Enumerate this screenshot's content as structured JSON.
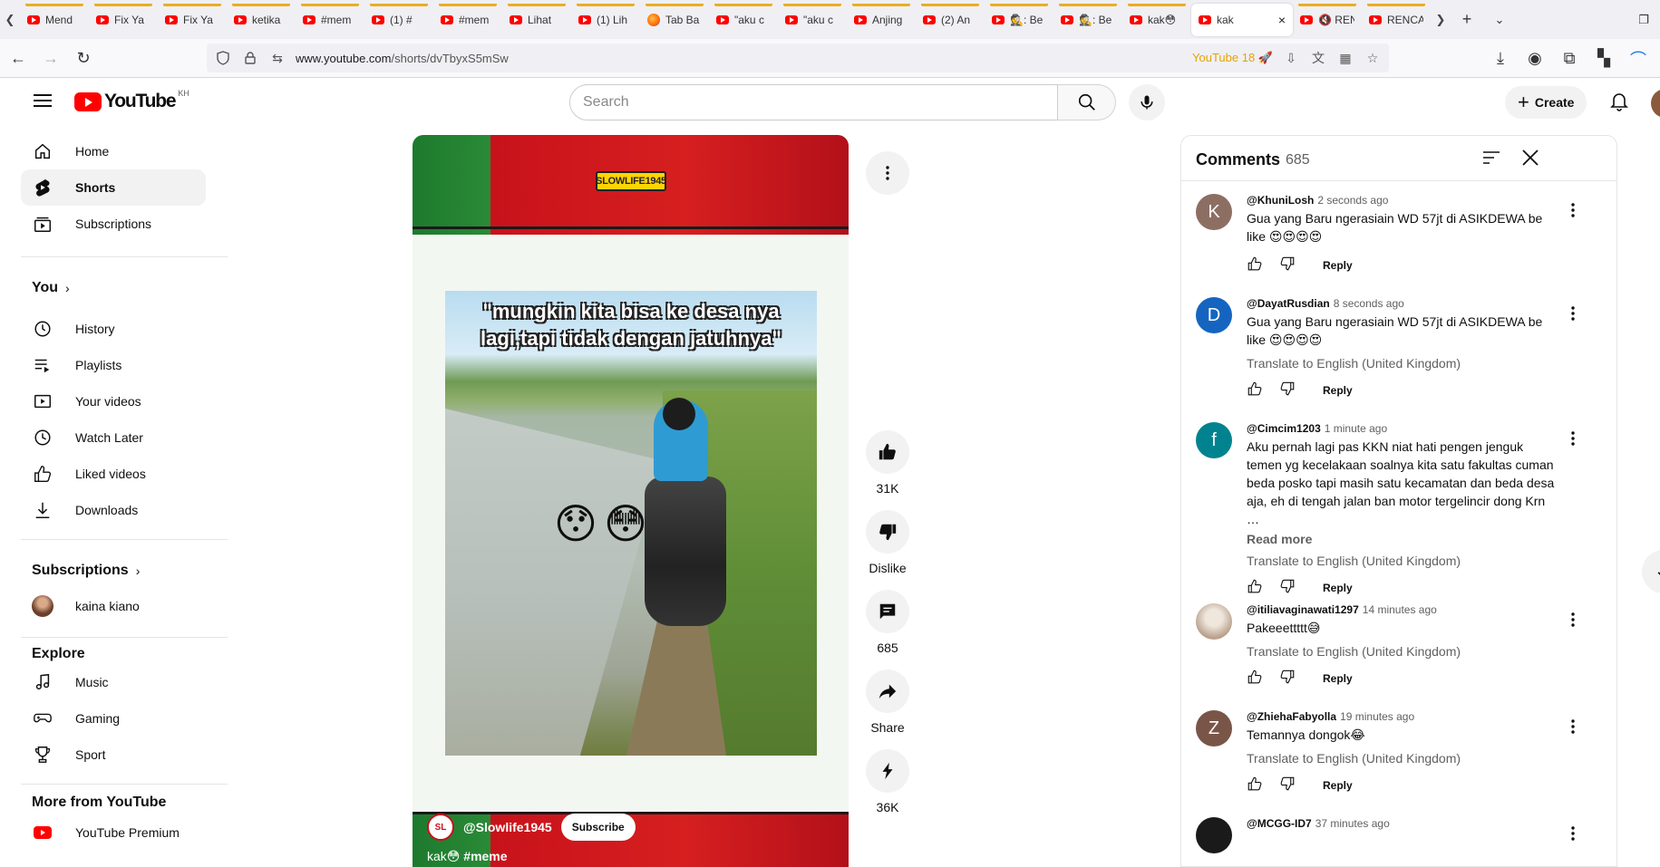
{
  "browser": {
    "tabs": [
      {
        "label": "Mend",
        "icon": "youtube-favicon"
      },
      {
        "label": "Fix Ya",
        "icon": "youtube-favicon"
      },
      {
        "label": "Fix Ya",
        "icon": "youtube-favicon"
      },
      {
        "label": "ketika",
        "icon": "youtube-favicon"
      },
      {
        "label": "#mem",
        "icon": "youtube-favicon"
      },
      {
        "label": "(1) #",
        "icon": "youtube-favicon"
      },
      {
        "label": "#mem",
        "icon": "youtube-favicon"
      },
      {
        "label": "Lihat",
        "icon": "youtube-favicon"
      },
      {
        "label": "(1) Lih",
        "icon": "youtube-favicon"
      },
      {
        "label": "Tab Ba",
        "icon": "firefox-favicon"
      },
      {
        "label": "\"aku c",
        "icon": "youtube-favicon"
      },
      {
        "label": "\"aku c",
        "icon": "youtube-favicon"
      },
      {
        "label": "Anjing",
        "icon": "youtube-favicon"
      },
      {
        "label": "(2) An",
        "icon": "youtube-favicon"
      },
      {
        "label": "🕵: Be",
        "icon": "youtube-favicon"
      },
      {
        "label": "🕵: Be",
        "icon": "youtube-favicon"
      },
      {
        "label": "kak😳",
        "icon": "youtube-favicon"
      }
    ],
    "active_tab": {
      "label": "kak",
      "close": "×"
    },
    "tabs_after": [
      {
        "label": "🔇 RENCA",
        "icon": "youtube-favicon"
      },
      {
        "label": "RENCA",
        "icon": "youtube-favicon"
      }
    ],
    "url_host": "www.youtube.com",
    "url_path": "/shorts/dvTbyxS5mSw",
    "extension_label": "YouTube 18 🚀"
  },
  "masthead": {
    "logo_text": "YouTube",
    "country_code": "KH",
    "search_placeholder": "Search",
    "create_label": "Create"
  },
  "sidebar": {
    "main": [
      {
        "label": "Home",
        "icon": "home-icon"
      },
      {
        "label": "Shorts",
        "icon": "shorts-icon"
      },
      {
        "label": "Subscriptions",
        "icon": "subscriptions-icon"
      }
    ],
    "you_heading": "You",
    "you": [
      {
        "label": "History",
        "icon": "history-icon"
      },
      {
        "label": "Playlists",
        "icon": "playlists-icon"
      },
      {
        "label": "Your videos",
        "icon": "your-videos-icon"
      },
      {
        "label": "Watch Later",
        "icon": "watch-later-icon"
      },
      {
        "label": "Liked videos",
        "icon": "liked-videos-icon"
      },
      {
        "label": "Downloads",
        "icon": "downloads-icon"
      }
    ],
    "subscriptions_heading": "Subscriptions",
    "subscriptions": [
      {
        "label": "kaina kiano"
      }
    ],
    "explore_heading": "Explore",
    "explore": [
      {
        "label": "Music",
        "icon": "music-icon"
      },
      {
        "label": "Gaming",
        "icon": "gaming-icon"
      },
      {
        "label": "Sport",
        "icon": "sport-icon"
      }
    ],
    "more_heading": "More from YouTube",
    "more": [
      {
        "label": "YouTube Premium",
        "icon": "youtube-premium-icon"
      }
    ]
  },
  "short": {
    "watermark": "SLOWLIFE1945",
    "overlay_text": "\"mungkin kita bisa ke desa nya lagi,tapi tidak dengan jatuhnya\"",
    "emoji_1": "😯",
    "emoji_2": "😳",
    "channel_avatar_text": "SL",
    "channel": "@Slowlife1945",
    "subscribe_label": "Subscribe",
    "title_prefix": "kak😳",
    "title_hashtag": "#meme"
  },
  "actions": {
    "likes": "31K",
    "dislike_label": "Dislike",
    "comments": "685",
    "share_label": "Share",
    "remix": "36K"
  },
  "comments_panel": {
    "title": "Comments",
    "count": "685",
    "items": [
      {
        "initial": "K",
        "avatar_color": "#8d6e63",
        "author": "@KhuniLosh",
        "time": "2 seconds ago",
        "text": "Gua yang Baru ngerasiain WD 57jt di ASIKDEWA be like 😍😍😍😍",
        "reply": "Reply"
      },
      {
        "initial": "D",
        "avatar_color": "#1565c0",
        "author": "@DayatRusdian",
        "time": "8 seconds ago",
        "text": "Gua yang Baru ngerasiain WD 57jt di ASIKDEWA be like 😍😍😍😍",
        "translate": "Translate to English (United Kingdom)",
        "reply": "Reply"
      },
      {
        "initial": "f",
        "avatar_color": "#00838f",
        "author": "@Cimcim1203",
        "time": "1 minute ago",
        "text": "Aku pernah lagi pas KKN niat hati pengen jenguk temen yg kecelakaan soalnya kita satu fakultas cuman beda posko tapi masih satu kecamatan dan beda desa aja, eh di tengah jalan ban motor tergelincir dong Krn …",
        "read_more": "Read more",
        "translate": "Translate to English (United Kingdom)",
        "reply": "Reply"
      },
      {
        "initial": "",
        "avatar_color": "#c9b8a6",
        "author": "@itiliavaginawati1297",
        "time": "14 minutes ago",
        "text": "Pakeeettttt😅",
        "translate": "Translate to English (United Kingdom)",
        "reply": "Reply"
      },
      {
        "initial": "Z",
        "avatar_color": "#795548",
        "author": "@ZhiehaFabyolla",
        "time": "19 minutes ago",
        "text": "Temannya dongok😂",
        "translate": "Translate to English (United Kingdom)",
        "reply": "Reply"
      },
      {
        "initial": "",
        "avatar_color": "#1a1a1a",
        "author": "@MCGG-ID7",
        "time": "37 minutes ago"
      }
    ]
  }
}
